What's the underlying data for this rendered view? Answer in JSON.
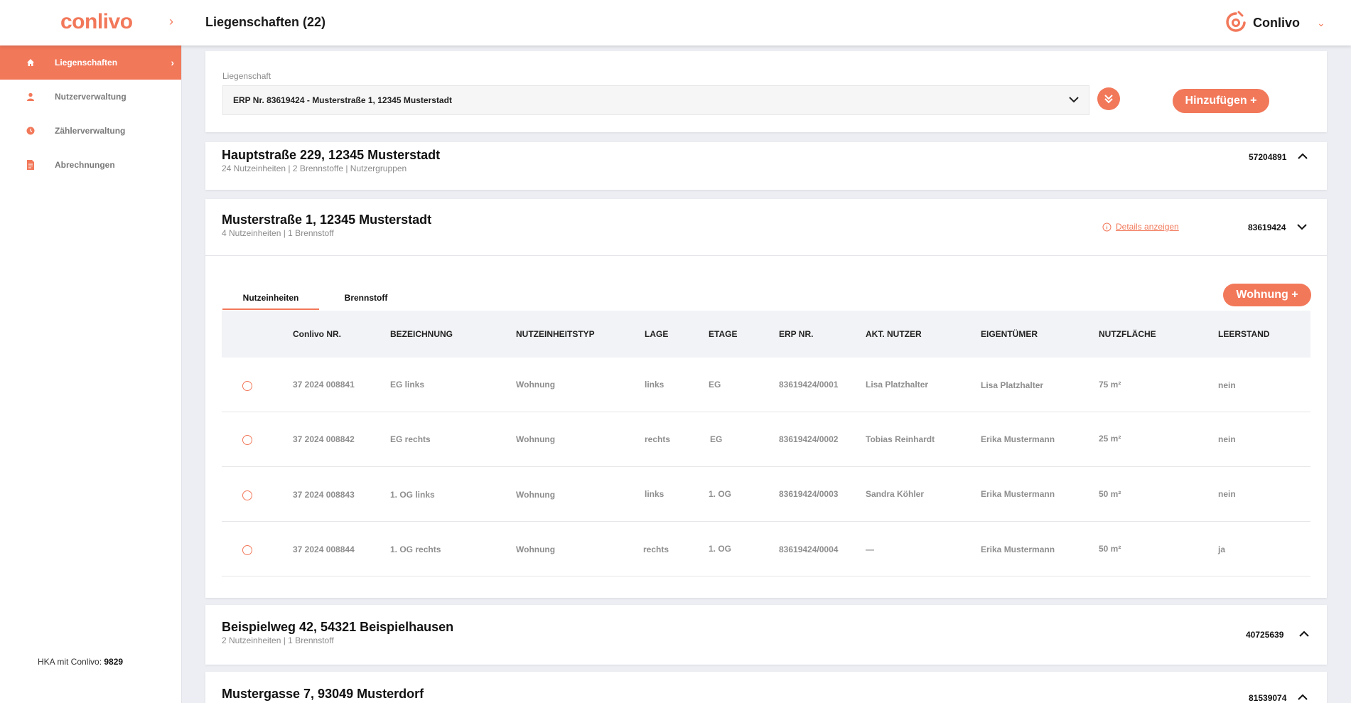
{
  "brand": {
    "logo_text": "conlivo",
    "accent": "#f2785a"
  },
  "header": {
    "title": "Liegenschaften (22)",
    "user_name": "Conlivo"
  },
  "sidebar": {
    "items": [
      {
        "label": "Liegenschaften",
        "icon": "home-icon",
        "active": true
      },
      {
        "label": "Nutzerverwaltung",
        "icon": "user-icon"
      },
      {
        "label": "Zählerverwaltung",
        "icon": "clock-icon"
      },
      {
        "label": "Abrechnungen",
        "icon": "document-icon"
      }
    ],
    "footer_label": "HKA mit Conlivo:",
    "footer_value": "9829"
  },
  "filter": {
    "label": "Liegenschaft",
    "selected": "ERP Nr. 83619424  - Musterstraße 1, 12345 Musterstadt",
    "add_button": "Hinzufügen +"
  },
  "properties": [
    {
      "title": "Hauptstraße 229, 12345 Musterstadt",
      "sub": "24 Nutzeinheiten | 2 Brennstoffe | Nutzergruppen",
      "number": "57204891"
    },
    {
      "title": "Musterstraße 1, 12345 Musterstadt",
      "sub": "4 Nutzeinheiten | 1 Brennstoff",
      "number": "83619424",
      "details_link": "Details anzeigen"
    },
    {
      "title": "Beispielweg 42, 54321 Beispielhausen",
      "sub": "2 Nutzeinheiten | 1 Brennstoff",
      "number": "40725639"
    },
    {
      "title": "Mustergasse 7,  93049 Musterdorf",
      "number": "81539074"
    }
  ],
  "tabs": [
    "Nutzeinheiten",
    "Brennstoff"
  ],
  "wohnung_button": "Wohnung +",
  "table": {
    "columns": [
      "Conlivo NR.",
      "BEZEICHNUNG",
      "NUTZEINHEITSTYP",
      "LAGE",
      "ETAGE",
      "ERP NR.",
      "AKT. NUTZER",
      "EIGENTÜMER",
      "NUTZFLÄCHE",
      "LEERSTAND"
    ],
    "rows": [
      [
        "37 2024 008841",
        "EG links",
        "Wohnung",
        "links",
        "EG",
        "83619424/0001",
        "Lisa Platzhalter",
        "Lisa Platzhalter",
        "75 m²",
        "nein"
      ],
      [
        "37 2024 008842",
        "EG rechts",
        "Wohnung",
        "rechts",
        "EG",
        "83619424/0002",
        "Tobias Reinhardt",
        "Erika Mustermann",
        "25 m²",
        "nein"
      ],
      [
        "37 2024 008843",
        "1. OG links",
        "Wohnung",
        "links",
        "1. OG",
        "83619424/0003",
        "Sandra Köhler",
        "Erika Mustermann",
        "50 m²",
        "nein"
      ],
      [
        "37 2024 008844",
        "1. OG rechts",
        "Wohnung",
        "rechts",
        "1. OG",
        "83619424/0004",
        "—",
        "Erika Mustermann",
        "50 m²",
        "ja"
      ]
    ]
  }
}
